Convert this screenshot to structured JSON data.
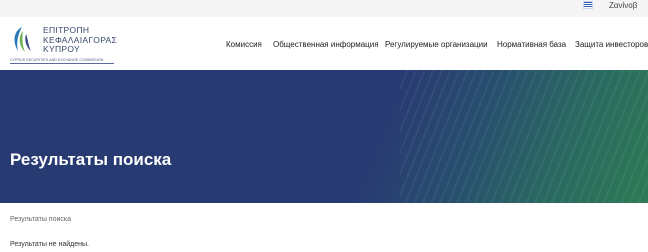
{
  "topbar": {
    "flag_icon": "greek-flag-icon",
    "language_label": "Ζανίνοβ",
    "colors": {
      "background": "#f4f4f4",
      "flag_blue": "#2d5fb0"
    }
  },
  "header": {
    "logo": {
      "line1": "ΕΠΙΤΡΟΠΗ",
      "line2": "ΚΕΦΑΛΑΙΑΓΟΡΑΣ",
      "line3": "ΚΥΠΡΟΥ",
      "subtitle": "CYPRUS SECURITIES AND EXCHANGE COMMISSION"
    },
    "nav": [
      {
        "label": "Комиссия"
      },
      {
        "label": "Общественная информация"
      },
      {
        "label": "Регулируемые организации"
      },
      {
        "label": "Нормативная база"
      },
      {
        "label": "Защита инвесторов"
      }
    ]
  },
  "hero": {
    "title": "Результаты поиска",
    "colors": {
      "primary": "#283a72",
      "accent": "#2e7a55"
    }
  },
  "breadcrumb": {
    "current": "Результаты поиска"
  },
  "results": {
    "message": "Результаты не найдены."
  }
}
